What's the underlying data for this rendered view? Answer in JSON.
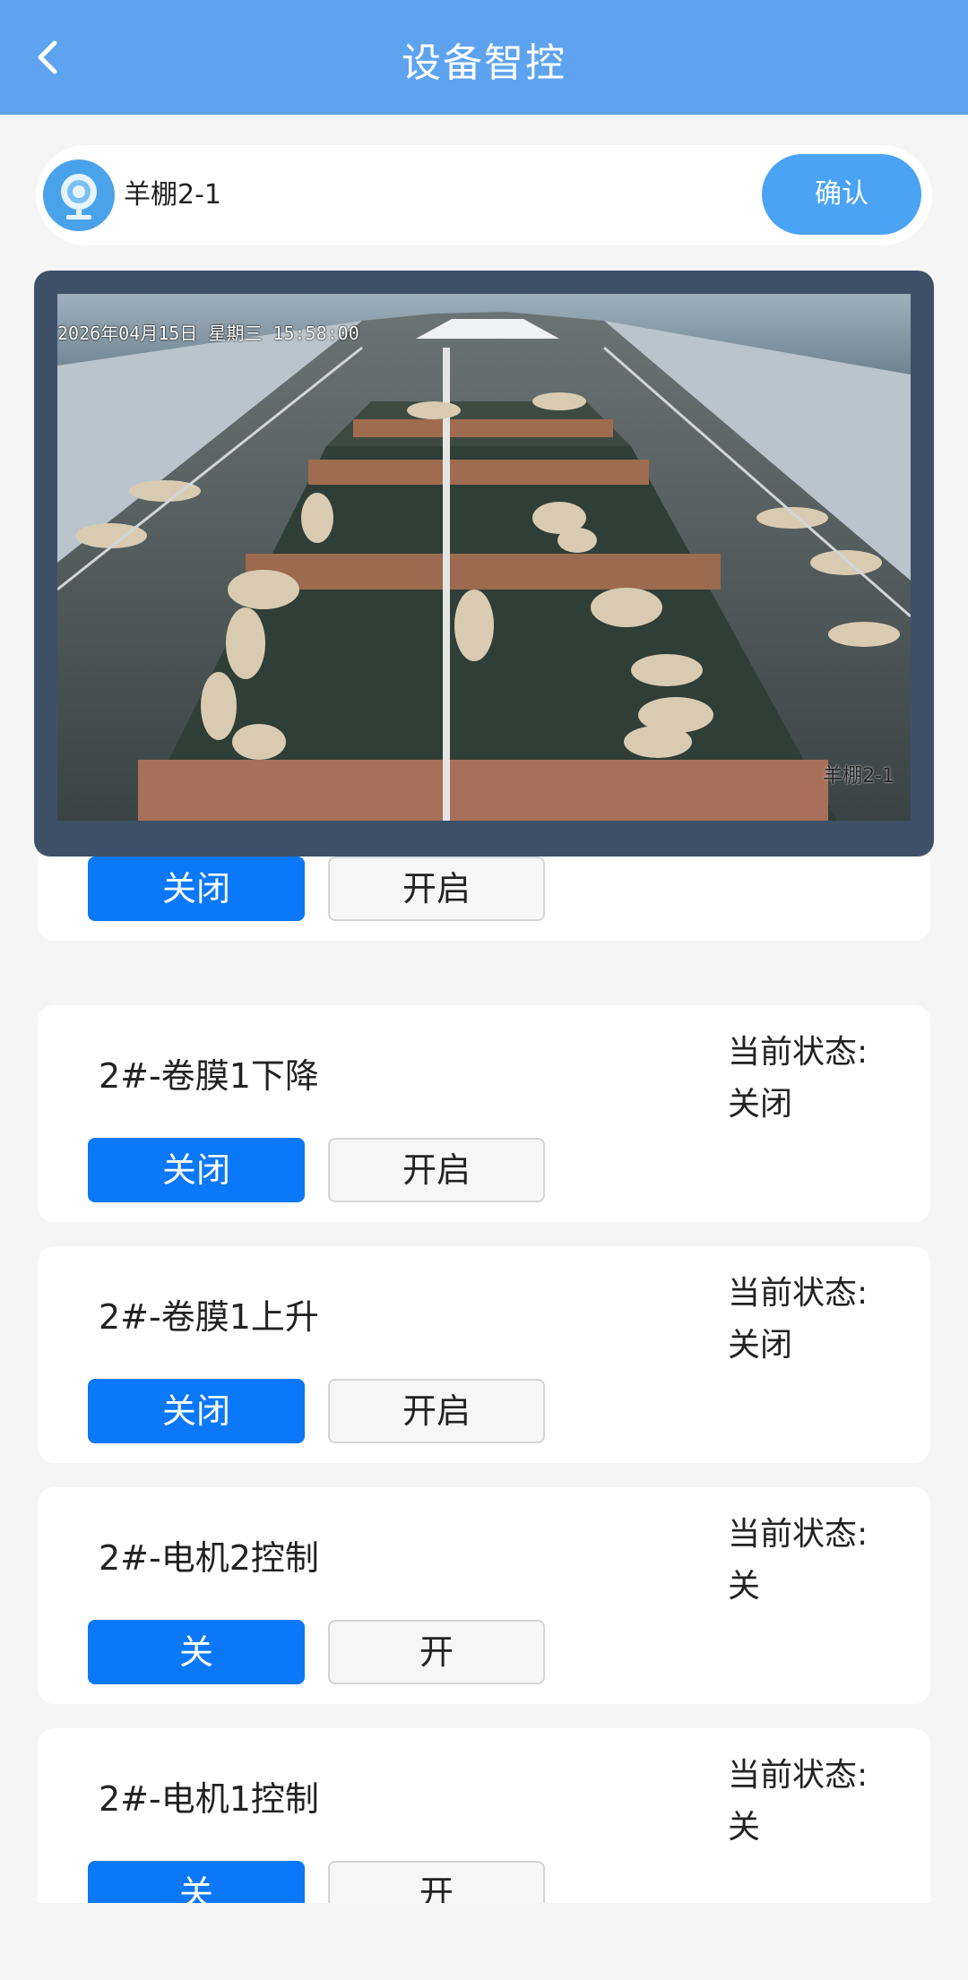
{
  "header": {
    "title": "设备智控",
    "back_icon": "chevron-left-icon"
  },
  "device": {
    "name": "羊棚2-1",
    "confirm_label": "确认",
    "icon": "camera-icon"
  },
  "video": {
    "timestamp": "2026年04月15日  星期三 15:58:00",
    "channel_label": "羊棚2-1"
  },
  "colors": {
    "header": "#5ea3ef",
    "primary": "#0a78f8",
    "confirm": "#4aa3f4"
  },
  "controls": [
    {
      "name": "",
      "status_label": "",
      "status": "",
      "off_label": "关闭",
      "on_label": "开启",
      "selected": "off"
    },
    {
      "name": "2#-卷膜1下降",
      "status_label": "当前状态:",
      "status": "关闭",
      "off_label": "关闭",
      "on_label": "开启",
      "selected": "off"
    },
    {
      "name": "2#-卷膜1上升",
      "status_label": "当前状态:",
      "status": "关闭",
      "off_label": "关闭",
      "on_label": "开启",
      "selected": "off"
    },
    {
      "name": "2#-电机2控制",
      "status_label": "当前状态:",
      "status": "关",
      "off_label": "关",
      "on_label": "开",
      "selected": "off"
    },
    {
      "name": "2#-电机1控制",
      "status_label": "当前状态:",
      "status": "关",
      "off_label": "关",
      "on_label": "开",
      "selected": "off"
    }
  ]
}
